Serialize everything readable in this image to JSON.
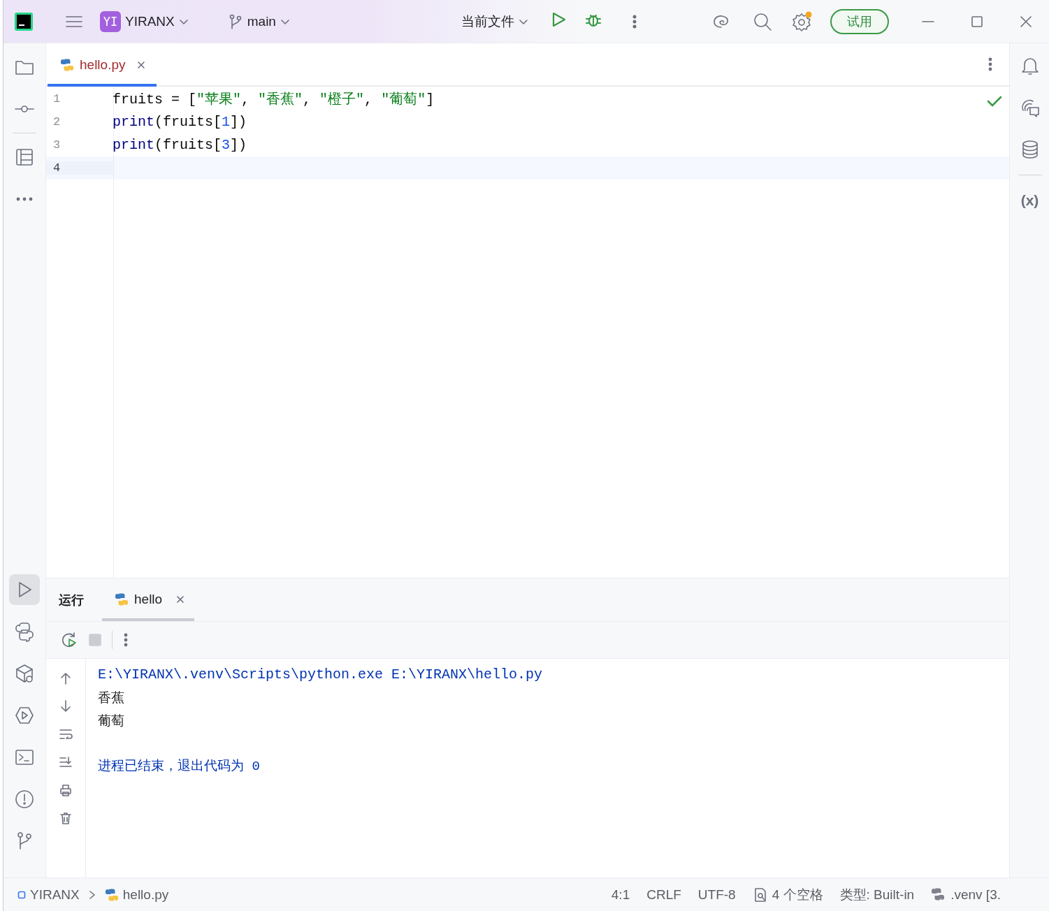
{
  "titlebar": {
    "project_badge": "YI",
    "project": "YIRANX",
    "branch": "main",
    "run_config": "当前文件",
    "trial_button": "试用"
  },
  "left_toolbar": {
    "top": [
      {
        "kind": "folder",
        "selected": false
      },
      {
        "kind": "commit",
        "selected": false
      },
      {
        "kind": "structure",
        "selected": false
      },
      {
        "kind": "more",
        "selected": false
      }
    ],
    "bottom": [
      {
        "kind": "run",
        "selected": true
      },
      {
        "kind": "python",
        "selected": false
      },
      {
        "kind": "packages",
        "selected": false
      },
      {
        "kind": "services",
        "selected": false
      },
      {
        "kind": "terminal",
        "selected": false
      },
      {
        "kind": "problems",
        "selected": false
      },
      {
        "kind": "git",
        "selected": false
      }
    ]
  },
  "right_toolbar": [
    {
      "kind": "bell"
    },
    {
      "kind": "chat"
    },
    {
      "kind": "database"
    },
    {
      "kind": "variables",
      "label": "(x)"
    }
  ],
  "editor": {
    "tabs": [
      {
        "label": "hello.py",
        "selected": true
      }
    ],
    "lines": [
      {
        "number": "1",
        "current": false,
        "tokens": [
          {
            "kind": "plain",
            "text": "fruits = ["
          },
          {
            "kind": "string",
            "text": "\"苹果\""
          },
          {
            "kind": "plain",
            "text": ", "
          },
          {
            "kind": "string",
            "text": "\"香蕉\""
          },
          {
            "kind": "plain",
            "text": ", "
          },
          {
            "kind": "string",
            "text": "\"橙子\""
          },
          {
            "kind": "plain",
            "text": ", "
          },
          {
            "kind": "string",
            "text": "\"葡萄\""
          },
          {
            "kind": "plain",
            "text": "]"
          }
        ]
      },
      {
        "number": "2",
        "current": false,
        "tokens": [
          {
            "kind": "func",
            "text": "print"
          },
          {
            "kind": "plain",
            "text": "(fruits["
          },
          {
            "kind": "number",
            "text": "1"
          },
          {
            "kind": "plain",
            "text": "])"
          }
        ]
      },
      {
        "number": "3",
        "current": false,
        "tokens": [
          {
            "kind": "func",
            "text": "print"
          },
          {
            "kind": "plain",
            "text": "(fruits["
          },
          {
            "kind": "number",
            "text": "3"
          },
          {
            "kind": "plain",
            "text": "])"
          }
        ]
      },
      {
        "number": "4",
        "current": true
      }
    ]
  },
  "run_panel": {
    "title": "运行",
    "tabs": [
      {
        "label": "hello",
        "selected": true
      }
    ],
    "console": [
      {
        "kind": "command",
        "text": "E:\\YIRANX\\.venv\\Scripts\\python.exe E:\\YIRANX\\hello.py"
      },
      {
        "kind": "output",
        "text": "香蕉"
      },
      {
        "kind": "output",
        "text": "葡萄"
      },
      {
        "kind": "exit",
        "text": "进程已结束，退出代码为 0"
      }
    ]
  },
  "status_bar": {
    "breadcrumbs": [
      {
        "kind": "project",
        "label": "YIRANX"
      },
      {
        "kind": "file",
        "label": "hello.py"
      }
    ],
    "caret": "4:1",
    "line_separator": "CRLF",
    "encoding": "UTF-8",
    "indent": "4 个空格",
    "file_type": "类型: Built-in",
    "interpreter": ".venv [3."
  }
}
